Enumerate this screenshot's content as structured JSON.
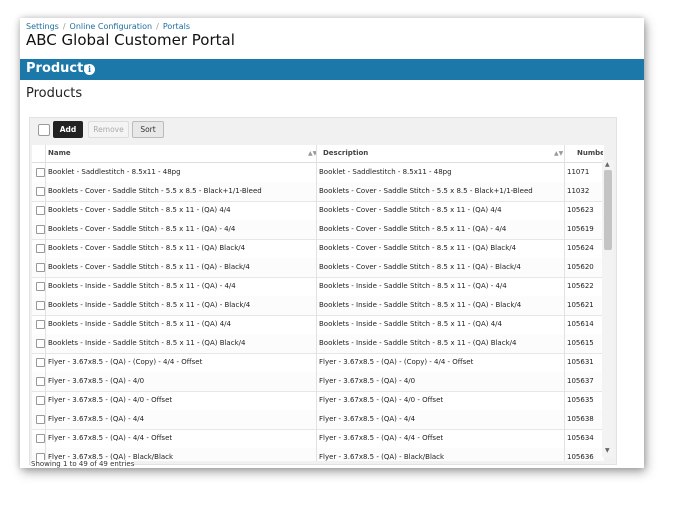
{
  "breadcrumb": [
    "Settings",
    "Online Configuration",
    "Portals"
  ],
  "portal_title": "ABC Global Customer Portal",
  "section_bar": {
    "title": "Products",
    "info_icon": "info-icon"
  },
  "page_heading": "Products",
  "toolbar": {
    "add_label": "Add",
    "remove_label": "Remove",
    "sort_label": "Sort"
  },
  "columns": {
    "name": "Name",
    "description": "Description",
    "number": "Number"
  },
  "rows": [
    {
      "name": "Booklet - Saddlestitch - 8.5x11 - 48pg",
      "description": "Booklet - Saddlestitch - 8.5x11 - 48pg",
      "number": "11071"
    },
    {
      "name": "Booklets - Cover - Saddle Stitch - 5.5 x 8.5 - Black+1/1-Bleed",
      "description": "Booklets - Cover - Saddle Stitch - 5.5 x 8.5 - Black+1/1-Bleed",
      "number": "11032"
    },
    {
      "name": "Booklets - Cover - Saddle Stitch - 8.5 x 11 - (QA) 4/4",
      "description": "Booklets - Cover - Saddle Stitch - 8.5 x 11 - (QA) 4/4",
      "number": "105623"
    },
    {
      "name": "Booklets - Cover - Saddle Stitch - 8.5 x 11 - (QA) - 4/4",
      "description": "Booklets - Cover - Saddle Stitch - 8.5 x 11 - (QA) - 4/4",
      "number": "105619"
    },
    {
      "name": "Booklets - Cover - Saddle Stitch - 8.5 x 11 - (QA) Black/4",
      "description": "Booklets - Cover - Saddle Stitch - 8.5 x 11 - (QA) Black/4",
      "number": "105624"
    },
    {
      "name": "Booklets - Cover - Saddle Stitch - 8.5 x 11 - (QA) - Black/4",
      "description": "Booklets - Cover - Saddle Stitch - 8.5 x 11 - (QA) - Black/4",
      "number": "105620"
    },
    {
      "name": "Booklets - Inside - Saddle Stitch - 8.5 x 11 - (QA) - 4/4",
      "description": "Booklets - Inside - Saddle Stitch - 8.5 x 11 - (QA) - 4/4",
      "number": "105622"
    },
    {
      "name": "Booklets - Inside - Saddle Stitch - 8.5 x 11 - (QA) - Black/4",
      "description": "Booklets - Inside - Saddle Stitch - 8.5 x 11 - (QA) - Black/4",
      "number": "105621"
    },
    {
      "name": "Booklets - Inside - Saddle Stitch - 8.5 x 11 - (QA) 4/4",
      "description": "Booklets - Inside - Saddle Stitch - 8.5 x 11 - (QA) 4/4",
      "number": "105614"
    },
    {
      "name": "Booklets - Inside - Saddle Stitch - 8.5 x 11 - (QA) Black/4",
      "description": "Booklets - Inside - Saddle Stitch - 8.5 x 11 - (QA) Black/4",
      "number": "105615"
    },
    {
      "name": "Flyer - 3.67x8.5 - (QA) - (Copy) - 4/4 - Offset",
      "description": "Flyer - 3.67x8.5 - (QA) - (Copy) - 4/4 - Offset",
      "number": "105631"
    },
    {
      "name": "Flyer - 3.67x8.5 - (QA) - 4/0",
      "description": "Flyer - 3.67x8.5 - (QA) - 4/0",
      "number": "105637"
    },
    {
      "name": "Flyer - 3.67x8.5 - (QA) - 4/0 - Offset",
      "description": "Flyer - 3.67x8.5 - (QA) - 4/0 - Offset",
      "number": "105635"
    },
    {
      "name": "Flyer - 3.67x8.5 - (QA) - 4/4",
      "description": "Flyer - 3.67x8.5 - (QA) - 4/4",
      "number": "105638"
    },
    {
      "name": "Flyer - 3.67x8.5 - (QA) - 4/4 - Offset",
      "description": "Flyer - 3.67x8.5 - (QA) - 4/4 - Offset",
      "number": "105634"
    },
    {
      "name": "Flyer - 3.67x8.5 - (QA) - Black/Black",
      "description": "Flyer - 3.67x8.5 - (QA) - Black/Black",
      "number": "105636"
    }
  ],
  "footer": "Showing 1 to 49 of 49 entries",
  "colors": {
    "section_bar": "#1b78a8",
    "link": "#1e6fa0",
    "add_button": "#222222"
  }
}
